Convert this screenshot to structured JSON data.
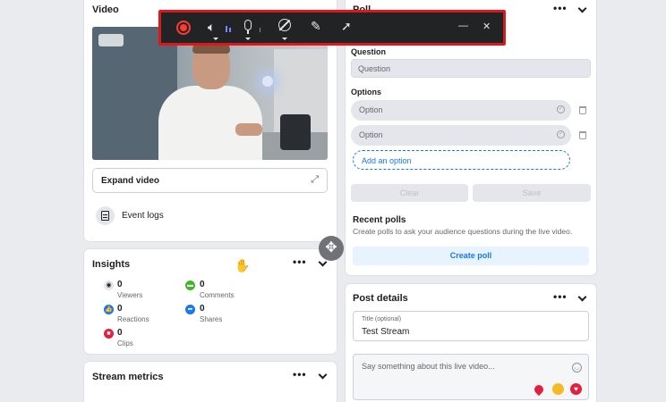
{
  "video_card": {
    "title": "Video",
    "expand_label": "Expand video",
    "event_logs_label": "Event logs"
  },
  "insights": {
    "title": "Insights",
    "stats": [
      {
        "value": "0",
        "label": "Viewers",
        "color": "#e4e6eb"
      },
      {
        "value": "0",
        "label": "Comments",
        "color": "#42b72a"
      },
      {
        "value": "0",
        "label": "Reactions",
        "color": "#1877f2"
      },
      {
        "value": "0",
        "label": "Shares",
        "color": "#1877f2"
      },
      {
        "value": "0",
        "label": "Clips",
        "color": "#e41e3f"
      }
    ]
  },
  "stream_metrics": {
    "title": "Stream metrics"
  },
  "polls": {
    "title_partial": "Poll",
    "question_label": "Question",
    "question_placeholder": "Question",
    "options_label": "Options",
    "option_placeholders": [
      "Option",
      "Option"
    ],
    "add_option_label": "Add an option",
    "clear_label": "Clear",
    "save_label": "Save",
    "recent_title": "Recent polls",
    "recent_desc": "Create polls to ask your audience questions during the live video.",
    "create_label": "Create poll"
  },
  "post_details": {
    "title": "Post details",
    "title_field_label": "Title (optional)",
    "title_field_value": "Test Stream",
    "description_placeholder": "Say something about this live video..."
  },
  "recorder_toolbar": {
    "icons": [
      "record-icon",
      "speaker-icon",
      "microphone-icon",
      "camera-off-icon",
      "pencil-icon",
      "cursor-icon",
      "minimize-icon",
      "close-icon"
    ],
    "accent": "#e0161c"
  },
  "icons": {
    "expand": "⤢",
    "minimize": "—",
    "close": "✕",
    "move": "✥",
    "hand": "✋"
  }
}
